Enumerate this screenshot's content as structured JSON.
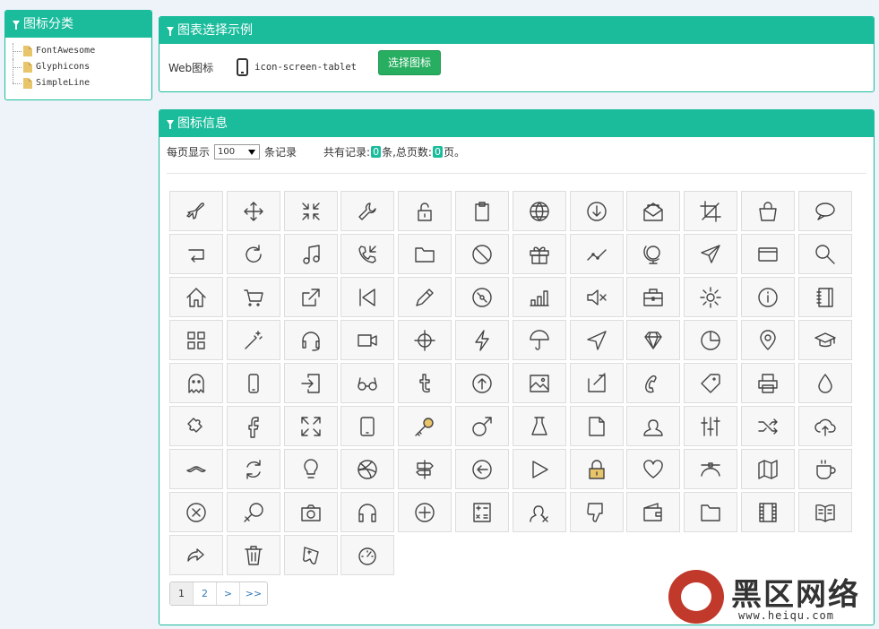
{
  "sidebar": {
    "title": "图标分类",
    "items": [
      {
        "label": "FontAwesome"
      },
      {
        "label": "Glyphicons"
      },
      {
        "label": "SimpleLine"
      }
    ]
  },
  "example": {
    "title": "图表选择示例",
    "label": "Web图标",
    "icon_name": "icon-screen-tablet",
    "button": "选择图标"
  },
  "info": {
    "title": "图标信息",
    "per_page_label": "每页显示",
    "per_page_value": "100",
    "per_page_unit": "条记录",
    "total_prefix": "共有记录:",
    "total_records": "0",
    "total_mid": "条,总页数:",
    "total_pages": "0",
    "total_suffix": "页。"
  },
  "icons": [
    "plane",
    "move",
    "shrink",
    "wrench",
    "lock-open",
    "clipboard",
    "globe",
    "arrow-down-circle",
    "envelope-open",
    "crop",
    "handbag",
    "bubble",
    "action-undo",
    "refresh",
    "music-tone",
    "call-in",
    "folder",
    "ban",
    "present",
    "graph",
    "globe-alt",
    "paper-plane",
    "credit-card",
    "magnifier",
    "home",
    "basket",
    "share-alt",
    "control-start",
    "pencil",
    "disc",
    "bar-chart",
    "volume-off",
    "briefcase",
    "settings",
    "info",
    "notebook",
    "grid",
    "magic-wand",
    "earphones-alt",
    "camrecorder",
    "target",
    "energy",
    "umbrella",
    "cursor",
    "diamond",
    "pie-chart",
    "location-pin",
    "graduation",
    "ghost",
    "screen-smartphone",
    "login",
    "eyeglass",
    "social-tumblr",
    "arrow-up-circle",
    "picture",
    "note",
    "call-end",
    "tag",
    "printer",
    "drop",
    "puzzle",
    "social-facebook",
    "size-fullscreen",
    "screen-tablet",
    "key",
    "symbol-male",
    "chemistry",
    "doc",
    "user-female",
    "equalizer",
    "shuffle",
    "cloud-upload",
    "mustache",
    "reload",
    "bulb",
    "social-dribbble",
    "directions",
    "arrow-left-circle",
    "control-play",
    "lock",
    "heart",
    "vector",
    "map",
    "cup",
    "close",
    "symbol-female",
    "camera",
    "earphones",
    "plus",
    "calculator",
    "user-unfollow",
    "dislike",
    "wallet",
    "folder-alt",
    "film",
    "book-open",
    "share",
    "trash",
    "game-controller",
    "speedometer"
  ],
  "pagination": [
    "1",
    "2",
    ">",
    ">>"
  ],
  "watermark": {
    "text": "黑区网络",
    "url": "www.heiqu.com"
  }
}
